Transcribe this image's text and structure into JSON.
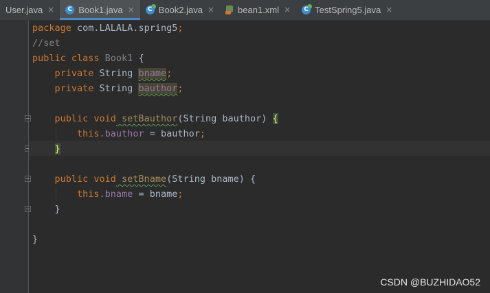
{
  "tabs": [
    {
      "label": "User.java",
      "icon": "java-class-icon",
      "active": false,
      "close": "×"
    },
    {
      "label": "Book1.java",
      "icon": "java-class-icon",
      "active": true,
      "close": "×"
    },
    {
      "label": "Book2.java",
      "icon": "java-class-icon",
      "active": false,
      "close": "×"
    },
    {
      "label": "bean1.xml",
      "icon": "xml-file-icon",
      "active": false,
      "close": "×"
    },
    {
      "label": "TestSpring5.java",
      "icon": "java-test-class-icon",
      "active": false,
      "close": "×"
    }
  ],
  "code": {
    "l1_kw": "package",
    "l1_pkg": " com.LALALA.spring5",
    "l1_semi": ";",
    "l2": "//set",
    "l3_kw": "public class",
    "l3_name": " Book1",
    "l3_rest": " {",
    "l4_kw": "    private",
    "l4_type": " String ",
    "l4_field": "bname",
    "l4_semi": ";",
    "l5_kw": "    private",
    "l5_type": " String ",
    "l5_field": "bauthor",
    "l5_semi": ";",
    "l7_kw": "    public void",
    "l7_method": " setBauthor",
    "l7_params": "(String bauthor)",
    "l7_brace": "{",
    "l8_this": "        this",
    "l8_field": ".bauthor",
    "l8_rest": " = bauthor",
    "l8_semi": ";",
    "l9_brace": "}",
    "l11_kw": "    public void",
    "l11_method": " setBname",
    "l11_params": "(String bname) {",
    "l12_this": "        this",
    "l12_field": ".bname",
    "l12_rest": " = bname",
    "l12_semi": ";",
    "l13": "    }",
    "l15": "}"
  },
  "watermark": "CSDN @BUZHIDAO52"
}
